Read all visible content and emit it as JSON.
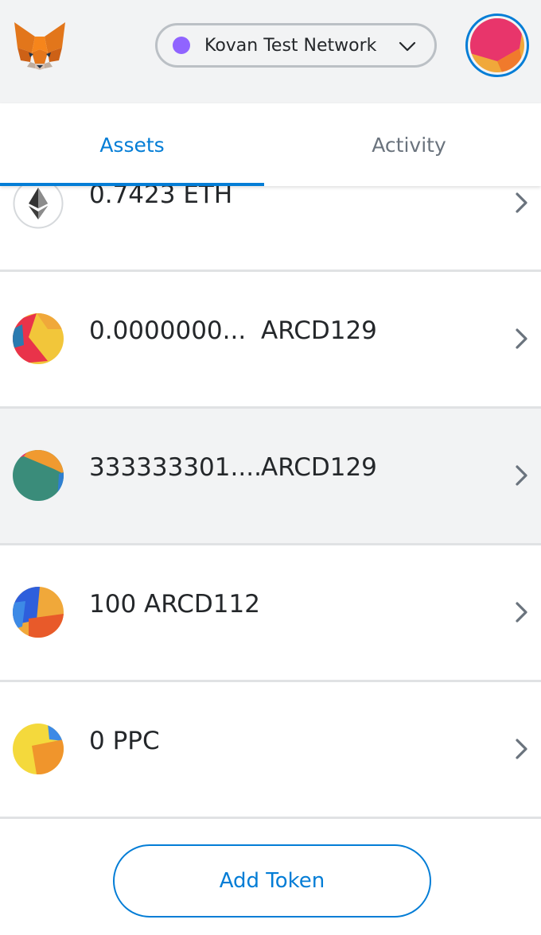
{
  "header": {
    "network_label": "Kovan Test Network",
    "network_dot_color": "#9064ff",
    "accent_color": "#037dd6",
    "logo_icon": "metamask-fox-icon",
    "account_icon": "identicon"
  },
  "tabs": [
    {
      "label": "Assets",
      "active": true
    },
    {
      "label": "Activity",
      "active": false
    }
  ],
  "assets": [
    {
      "amount": "0.7423 ETH",
      "symbol": "",
      "icon": "eth-icon"
    },
    {
      "amount": "0.0000000...",
      "symbol": "ARCD129",
      "icon": "identicon"
    },
    {
      "amount": "333333301....",
      "symbol": "ARCD129",
      "icon": "identicon",
      "hovered": true
    },
    {
      "amount": "100 ARCD112",
      "symbol": "",
      "icon": "identicon"
    },
    {
      "amount": "0 PPC",
      "symbol": "",
      "icon": "identicon"
    }
  ],
  "footer": {
    "add_token_label": "Add Token"
  }
}
